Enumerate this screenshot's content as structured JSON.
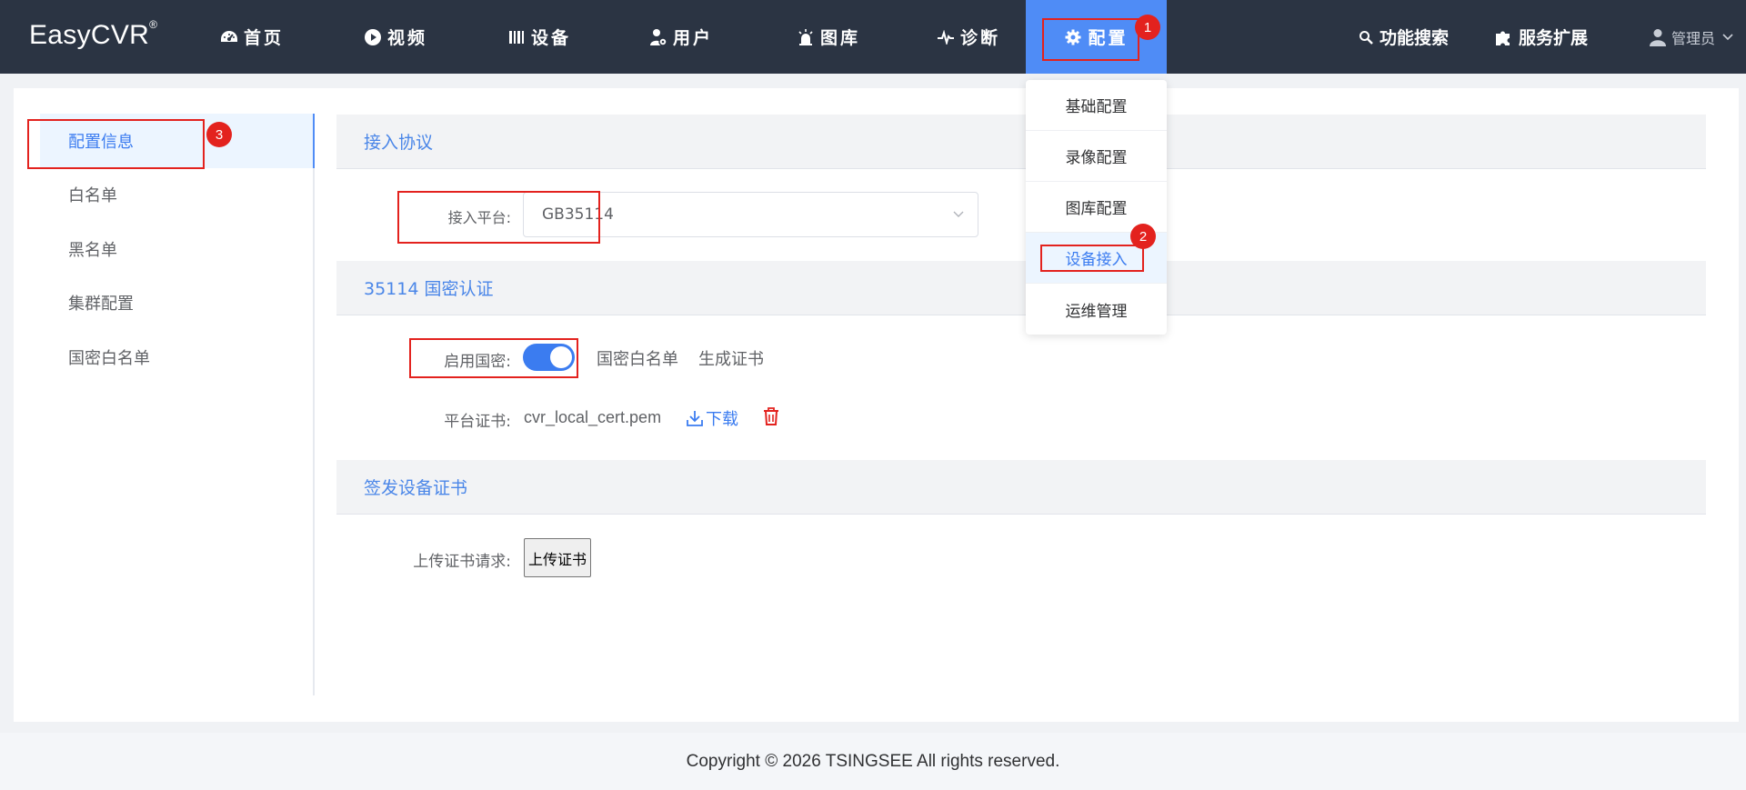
{
  "app": {
    "logo": "EasyCVR",
    "logo_mark": "®"
  },
  "nav": {
    "items": [
      {
        "label": "首页",
        "icon": "dashboard-icon"
      },
      {
        "label": "视频",
        "icon": "play-circle-icon"
      },
      {
        "label": "设备",
        "icon": "device-bars-icon"
      },
      {
        "label": "用户",
        "icon": "user-gear-icon"
      },
      {
        "label": "图库",
        "icon": "alarm-light-icon"
      },
      {
        "label": "诊断",
        "icon": "pulse-icon"
      },
      {
        "label": "配置",
        "icon": "gear-icon",
        "active": true
      }
    ],
    "search_label": "功能搜索",
    "extension_label": "服务扩展",
    "user_label": "管理员"
  },
  "config_dropdown": {
    "items": [
      "基础配置",
      "录像配置",
      "图库配置",
      "设备接入",
      "运维管理"
    ],
    "active": "设备接入"
  },
  "sidebar": {
    "items": [
      {
        "label": "配置信息",
        "active": true
      },
      {
        "label": "白名单"
      },
      {
        "label": "黑名单"
      },
      {
        "label": "集群配置"
      },
      {
        "label": "国密白名单"
      }
    ]
  },
  "content": {
    "section_access": {
      "title": "接入协议",
      "platform_label": "接入平台:",
      "platform_value": "GB35114"
    },
    "section_sm": {
      "title": "35114 国密认证",
      "enable_label": "启用国密:",
      "enable_on": true,
      "whitelist_link": "国密白名单",
      "gen_cert_link": "生成证书",
      "cert_label": "平台证书:",
      "cert_file": "cvr_local_cert.pem",
      "download_label": "下载"
    },
    "section_issue": {
      "title": "签发设备证书",
      "upload_label": "上传证书请求:",
      "upload_button": "上传证书"
    }
  },
  "annotations": [
    "1",
    "2",
    "3"
  ],
  "footer": {
    "copyright": "Copyright © 2026 TSINGSEE All rights reserved."
  },
  "colors": {
    "topbar": "#2b3443",
    "accent": "#4f8cf6",
    "link": "#3b7cf0",
    "danger": "#e3221e"
  }
}
